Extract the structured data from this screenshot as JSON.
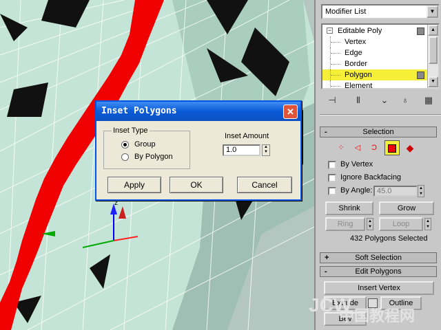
{
  "dialog": {
    "title": "Inset Polygons",
    "close_label": "✕",
    "inset_type_label": "Inset Type",
    "radio_group": "Group",
    "radio_by_polygon": "By Polygon",
    "selected_type": "Group",
    "inset_amount_label": "Inset Amount",
    "inset_amount_value": "1.0",
    "apply_label": "Apply",
    "ok_label": "OK",
    "cancel_label": "Cancel"
  },
  "panel": {
    "modifier_list": "Modifier List",
    "stack": [
      {
        "label": "Editable Poly",
        "level": 0,
        "selected": false
      },
      {
        "label": "Vertex",
        "level": 1,
        "selected": false
      },
      {
        "label": "Edge",
        "level": 1,
        "selected": false
      },
      {
        "label": "Border",
        "level": 1,
        "selected": false
      },
      {
        "label": "Polygon",
        "level": 1,
        "selected": true
      },
      {
        "label": "Element",
        "level": 1,
        "selected": false
      }
    ],
    "selection_rollout": "Selection",
    "by_vertex": "By Vertex",
    "ignore_backfacing": "Ignore Backfacing",
    "by_angle": "By Angle:",
    "angle_value": "45.0",
    "shrink": "Shrink",
    "grow": "Grow",
    "ring": "Ring",
    "loop": "Loop",
    "status": "432 Polygons Selected",
    "soft_selection_rollout": "Soft Selection",
    "edit_polygons_rollout": "Edit Polygons",
    "insert_vertex": "Insert Vertex",
    "extrude": "Extrude",
    "outline": "Outline",
    "bevel": "Bev",
    "rollout_minus": "-",
    "rollout_plus": "+"
  },
  "viewport": {
    "axis_z": "z"
  },
  "watermark": {
    "text1": "JCW",
    "text2": "中国教程网"
  },
  "colors": {
    "selection_red": "#f00000",
    "mesh_fill": "#bfe0d3",
    "dialog_title": "#0a5bd8",
    "stack_highlight": "#f5ef3a"
  }
}
